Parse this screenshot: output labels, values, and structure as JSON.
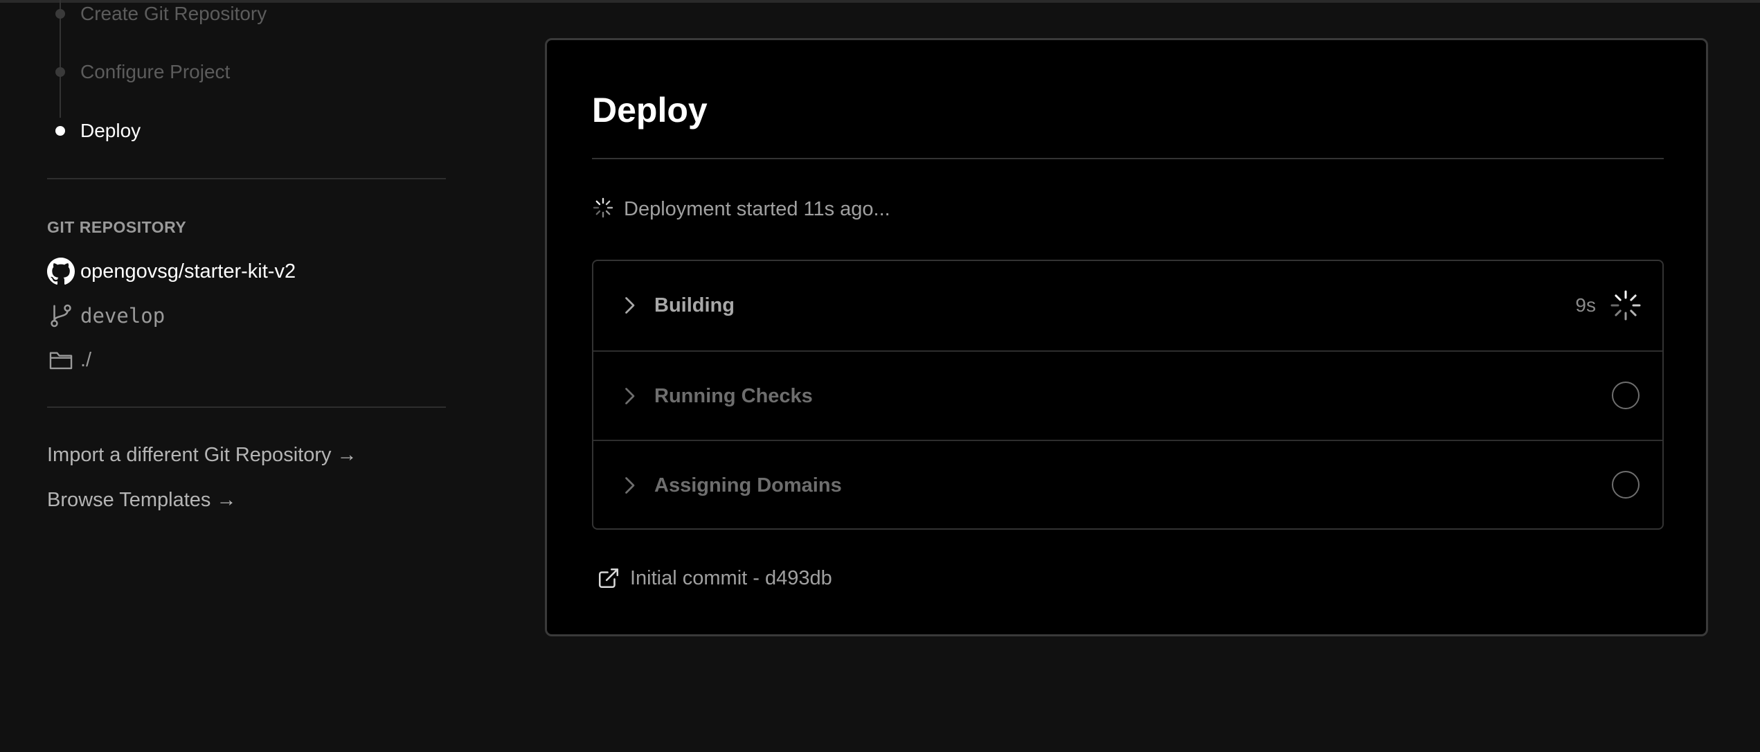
{
  "steps": [
    {
      "label": "Create Git Repository",
      "state": "done"
    },
    {
      "label": "Configure Project",
      "state": "done"
    },
    {
      "label": "Deploy",
      "state": "active"
    }
  ],
  "repository": {
    "heading": "GIT REPOSITORY",
    "name": "opengovsg/starter-kit-v2",
    "branch": "develop",
    "directory": "./"
  },
  "links": {
    "import_repo": "Import a different Git Repository →",
    "browse_templates": "Browse Templates →"
  },
  "deploy": {
    "title": "Deploy",
    "status": "Deployment started 11s ago...",
    "stages": [
      {
        "label": "Building",
        "time": "9s",
        "state": "in-progress",
        "icon": "spinner-icon"
      },
      {
        "label": "Running Checks",
        "time": "",
        "state": "pending",
        "icon": "pending-circle-icon"
      },
      {
        "label": "Assigning Domains",
        "time": "",
        "state": "pending",
        "icon": "pending-circle-icon"
      }
    ],
    "commit": "Initial commit - d493db"
  },
  "colors": {
    "background": "#111111",
    "card": "#000000",
    "text_active": "#ffffff",
    "text_muted": "#9a9a9a"
  }
}
